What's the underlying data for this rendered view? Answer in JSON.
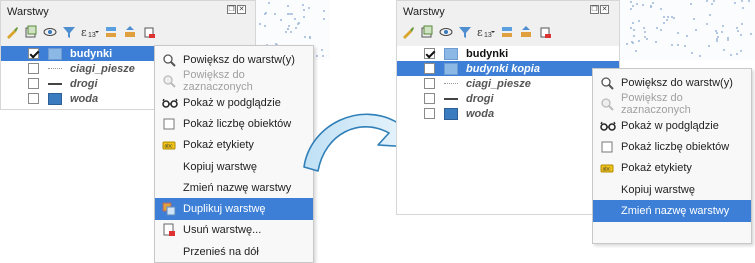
{
  "panel_title": "Warstwy",
  "left": {
    "layers": [
      {
        "name": "budynki",
        "checked": true,
        "symbol": "fill-light",
        "selected": true
      },
      {
        "name": "ciagi_piesze",
        "checked": false,
        "symbol": "line-dot"
      },
      {
        "name": "drogi",
        "checked": false,
        "symbol": "line-solid"
      },
      {
        "name": "woda",
        "checked": false,
        "symbol": "fill-dark"
      }
    ],
    "menu": [
      {
        "label": "Powiększ do warstw(y)",
        "icon": "zoom-icon",
        "disabled": false
      },
      {
        "label": "Powiększ do zaznaczonych",
        "icon": "zoom-selected-icon",
        "disabled": true
      },
      {
        "label": "Pokaż w podglądzie",
        "icon": "overview-glasses-icon",
        "disabled": false
      },
      {
        "label": "Pokaż liczbę obiektów",
        "icon": "checkbox-icon",
        "disabled": false
      },
      {
        "label": "Pokaż etykiety",
        "icon": "labels-icon",
        "disabled": false
      },
      {
        "label": "Kopiuj warstwę",
        "icon": "",
        "disabled": false
      },
      {
        "label": "Zmień nazwę warstwy",
        "icon": "",
        "disabled": false
      },
      {
        "label": "Duplikuj warstwę",
        "icon": "duplicate-layer-icon",
        "disabled": false,
        "highlighted": true
      },
      {
        "label": "Usuń warstwę...",
        "icon": "remove-layer-icon",
        "disabled": false
      },
      {
        "label": "Przenieś na dół",
        "icon": "",
        "disabled": false
      }
    ]
  },
  "right": {
    "layers": [
      {
        "name": "budynki",
        "checked": true,
        "symbol": "fill-light"
      },
      {
        "name": "budynki kopia",
        "checked": false,
        "symbol": "fill-light",
        "selected": true
      },
      {
        "name": "ciagi_piesze",
        "checked": false,
        "symbol": "line-dot"
      },
      {
        "name": "drogi",
        "checked": false,
        "symbol": "line-solid"
      },
      {
        "name": "woda",
        "checked": false,
        "symbol": "fill-dark"
      }
    ],
    "menu": [
      {
        "label": "Powiększ do warstw(y)",
        "icon": "zoom-icon",
        "disabled": false
      },
      {
        "label": "Powiększ do zaznaczonych",
        "icon": "zoom-selected-icon",
        "disabled": true
      },
      {
        "label": "Pokaż w podglądzie",
        "icon": "overview-glasses-icon",
        "disabled": false
      },
      {
        "label": "Pokaż liczbę obiektów",
        "icon": "checkbox-icon",
        "disabled": false
      },
      {
        "label": "Pokaż etykiety",
        "icon": "labels-icon",
        "disabled": false
      },
      {
        "label": "Kopiuj warstwę",
        "icon": "",
        "disabled": false
      },
      {
        "label": "Zmień nazwę warstwy",
        "icon": "",
        "disabled": false,
        "highlighted": true
      }
    ]
  },
  "colors": {
    "selection": "#3d7fd6",
    "arrow": "#5fa8dc"
  }
}
